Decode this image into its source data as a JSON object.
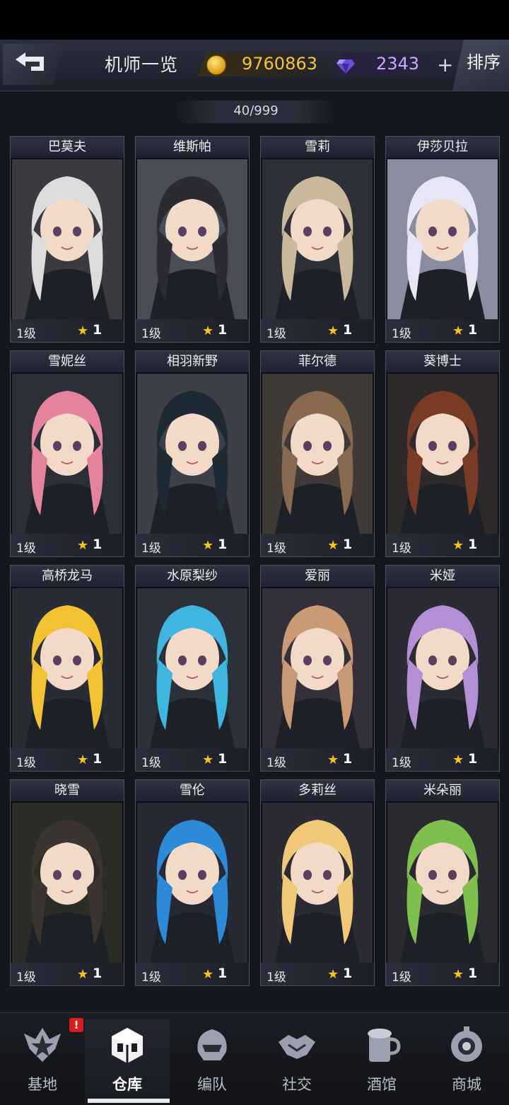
{
  "header": {
    "title": "机师一览",
    "coins": "9760863",
    "gems": "2343",
    "plus": "+",
    "sort": "排序"
  },
  "roster_count": "40/999",
  "pilots": [
    {
      "name": "巴莫夫",
      "level": "1级",
      "stars": "1",
      "hair": "#dcdcdc",
      "bg": "#3a3a40"
    },
    {
      "name": "维斯帕",
      "level": "1级",
      "stars": "1",
      "hair": "#2b2b33",
      "bg": "#4a4d58"
    },
    {
      "name": "雪莉",
      "level": "1级",
      "stars": "1",
      "hair": "#c9b99a",
      "bg": "#2d3038"
    },
    {
      "name": "伊莎贝拉",
      "level": "1级",
      "stars": "1",
      "hair": "#e6e6f5",
      "bg": "#8a8ca0"
    },
    {
      "name": "雪妮丝",
      "level": "1级",
      "stars": "1",
      "hair": "#e5839d",
      "bg": "#2c2e38"
    },
    {
      "name": "相羽新野",
      "level": "1级",
      "stars": "1",
      "hair": "#1d2a33",
      "bg": "#3d4048"
    },
    {
      "name": "菲尔德",
      "level": "1级",
      "stars": "1",
      "hair": "#8a6a4e",
      "bg": "#3f3a36"
    },
    {
      "name": "葵博士",
      "level": "1级",
      "stars": "1",
      "hair": "#7a3b26",
      "bg": "#2f2a2a"
    },
    {
      "name": "高桥龙马",
      "level": "1级",
      "stars": "1",
      "hair": "#f2c233",
      "bg": "#2a2c33"
    },
    {
      "name": "水原梨纱",
      "level": "1级",
      "stars": "1",
      "hair": "#3fb6e0",
      "bg": "#2c3038"
    },
    {
      "name": "爱丽",
      "level": "1级",
      "stars": "1",
      "hair": "#c99a74",
      "bg": "#33303a"
    },
    {
      "name": "米娅",
      "level": "1级",
      "stars": "1",
      "hair": "#b38fd6",
      "bg": "#2a2b33"
    },
    {
      "name": "晓雪",
      "level": "1级",
      "stars": "1",
      "hair": "#3b3430",
      "bg": "#2a2c26"
    },
    {
      "name": "雪伦",
      "level": "1级",
      "stars": "1",
      "hair": "#2c8ad8",
      "bg": "#262833"
    },
    {
      "name": "多莉丝",
      "level": "1级",
      "stars": "1",
      "hair": "#f0c878",
      "bg": "#2a2b33"
    },
    {
      "name": "米朵丽",
      "level": "1级",
      "stars": "1",
      "hair": "#7fbf4f",
      "bg": "#2a2b30"
    }
  ],
  "nav": [
    {
      "label": "基地",
      "icon": "base-icon"
    },
    {
      "label": "仓库",
      "icon": "warehouse-icon"
    },
    {
      "label": "编队",
      "icon": "formation-icon"
    },
    {
      "label": "社交",
      "icon": "handshake-icon"
    },
    {
      "label": "酒馆",
      "icon": "tavern-icon"
    },
    {
      "label": "商城",
      "icon": "shop-icon"
    }
  ],
  "alert": "!",
  "colors": {
    "coin": "#f5c343",
    "gem": "#c9a8ff",
    "star": "#f5c31a"
  }
}
